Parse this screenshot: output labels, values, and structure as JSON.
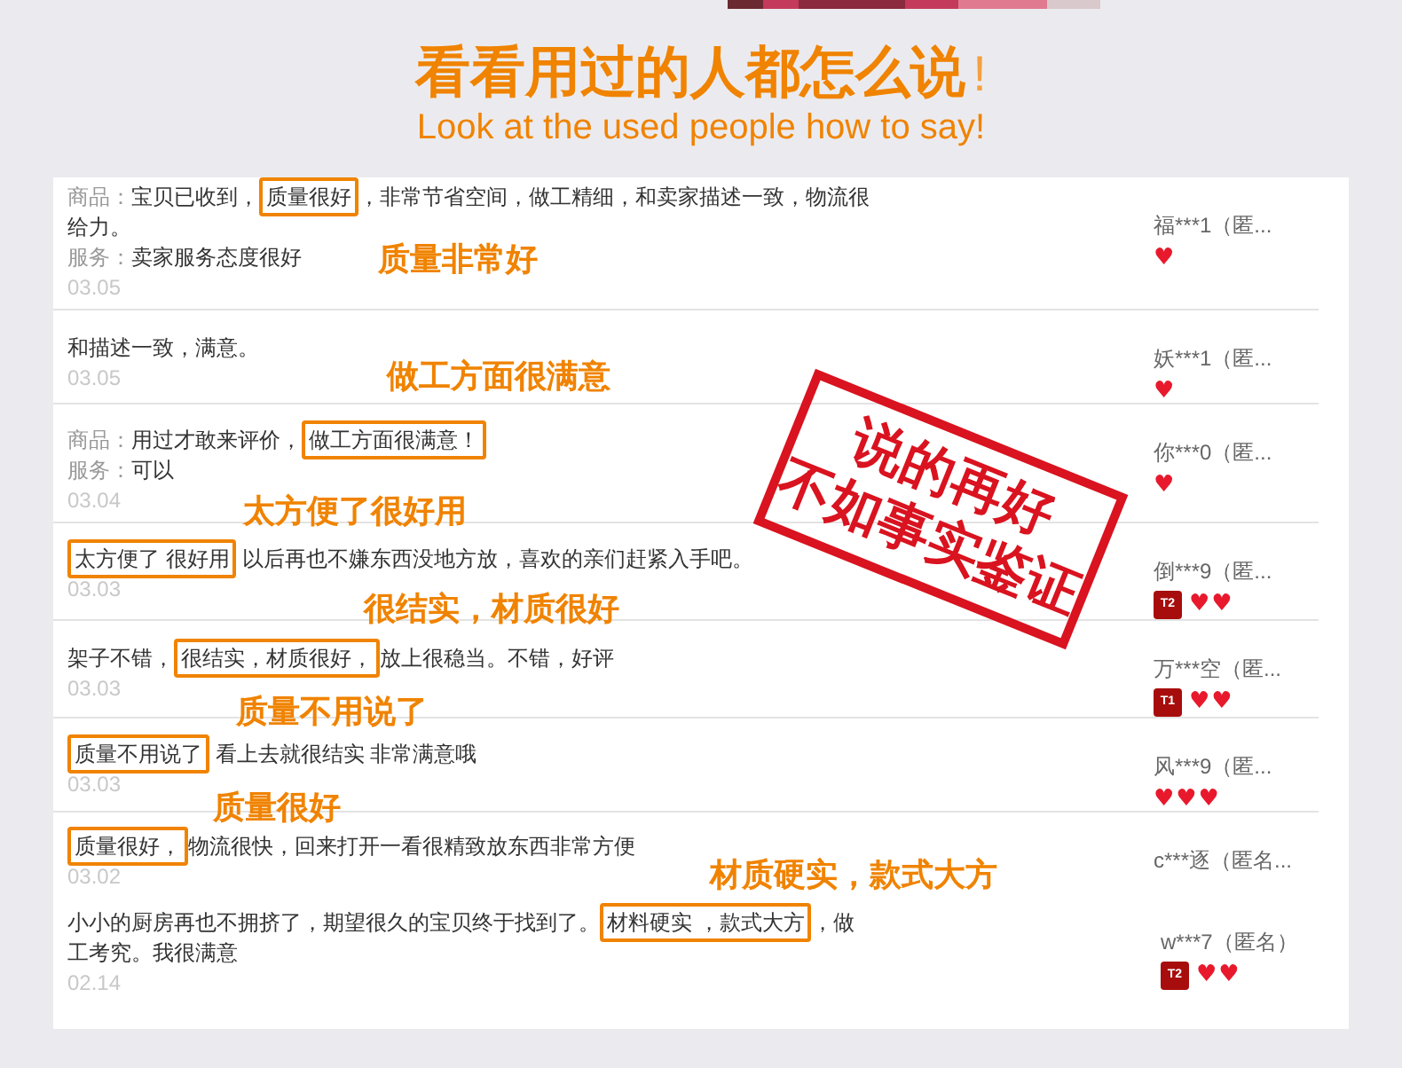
{
  "header": {
    "title": "看看用过的人都怎么说",
    "exclaim": "!",
    "subtitle": "Look at the used people how to say!"
  },
  "stamp": {
    "lines": [
      "说的再好",
      "不如事实鉴证"
    ]
  },
  "reviews": [
    {
      "lines": [
        {
          "label": "商品：",
          "before": "宝贝已收到，",
          "highlight": "质量很好",
          "after": "，非常节省空间，做工精细，和卖家描述一致，物流很给力。"
        },
        {
          "label": "服务：",
          "before": "卖家服务态度很好"
        }
      ],
      "date": "03.05",
      "callout": "质量非常好",
      "user": "福***1（匿...",
      "hearts": "♥"
    },
    {
      "lines": [
        {
          "before": "和描述一致，满意。"
        }
      ],
      "date": "03.05",
      "user": "妖***1（匿...",
      "hearts": "♥"
    },
    {
      "lines": [
        {
          "label": "商品：",
          "before": "用过才敢来评价，",
          "highlight": "做工方面很满意！"
        },
        {
          "label": "服务：",
          "before": "可以"
        }
      ],
      "date": "03.04",
      "callout": "做工方面很满意",
      "user": "你***0（匿...",
      "hearts": "♥"
    },
    {
      "lines": [
        {
          "highlight": "太方便了 很好用",
          "after": " 以后再也不嫌东西没地方放，喜欢的亲们赶紧入手吧。"
        }
      ],
      "date": "03.03",
      "callout": "太方便了很好用",
      "user": "倒***9（匿...",
      "badge": "T2",
      "hearts": "♥♥"
    },
    {
      "lines": [
        {
          "before": "架子不错，",
          "highlight": "很结实，材质很好，",
          "after": "放上很稳当。不错，好评"
        }
      ],
      "date": "03.03",
      "callout": "很结实，材质很好",
      "user": "万***空（匿...",
      "badge": "T1",
      "hearts": "♥♥"
    },
    {
      "lines": [
        {
          "highlight": "质量不用说了",
          "after": " 看上去就很结实 非常满意哦"
        }
      ],
      "date": "03.03",
      "callout": "质量不用说了",
      "user": "风***9（匿...",
      "hearts": "♥♥♥"
    },
    {
      "lines": [
        {
          "highlight": "质量很好，",
          "after": "物流很快，回来打开一看很精致放东西非常方便"
        }
      ],
      "date": "03.02",
      "callout": "质量很好",
      "user": "c***逐（匿名..."
    },
    {
      "lines": [
        {
          "before": "小小的厨房再也不拥挤了，期望很久的宝贝终于找到了。",
          "highlight": "材料硬实 ，款式大方",
          "after": "，做工考究。我很满意"
        }
      ],
      "date": "02.14",
      "callout": "材质硬实，款式大方",
      "user": "w***7（匿名）",
      "badge": "T2",
      "hearts": "♥♥"
    }
  ]
}
